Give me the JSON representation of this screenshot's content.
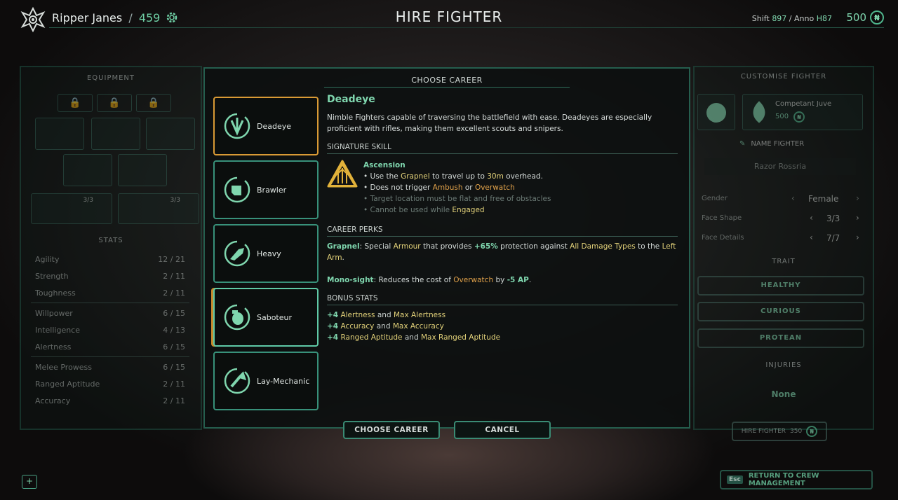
{
  "header": {
    "crew_name": "Ripper Janes",
    "separator": "/",
    "crew_points": "459",
    "title": "HIRE FIGHTER",
    "shift_label": "Shift",
    "shift_value": "897",
    "anno_label": "Anno",
    "anno_value": "H87",
    "currency": "500"
  },
  "left_panel": {
    "title": "EQUIPMENT",
    "weapons": [
      {
        "ammo": "3/3"
      },
      {
        "ammo": "3/3"
      }
    ],
    "stats_title": "STATS",
    "stats": [
      {
        "name": "Agility",
        "value": "12 / 21"
      },
      {
        "name": "Strength",
        "value": "2 / 11"
      },
      {
        "name": "Toughness",
        "value": "2 / 11"
      },
      {
        "name": "Willpower",
        "value": "6 / 15"
      },
      {
        "name": "Intelligence",
        "value": "4 / 13"
      },
      {
        "name": "Alertness",
        "value": "6 / 15"
      },
      {
        "name": "Melee Prowess",
        "value": "6 / 15"
      },
      {
        "name": "Ranged Aptitude",
        "value": "2 / 11"
      },
      {
        "name": "Accuracy",
        "value": "2 / 11"
      }
    ]
  },
  "right_panel": {
    "title": "CUSTOMISE FIGHTER",
    "juve_name": "Competant Juve",
    "juve_cost": "500",
    "name_label": "NAME FIGHTER",
    "fighter_name": "Razor Rossria",
    "gender_label": "Gender",
    "gender_value": "Female",
    "face_shape_label": "Face Shape",
    "face_shape_value": "3/3",
    "face_details_label": "Face Details",
    "face_details_value": "7/7",
    "trait_title": "TRAIT",
    "traits": [
      "HEALTHY",
      "CURIOUS",
      "PROTEAN"
    ],
    "injuries_title": "INJURIES",
    "injuries_value": "None",
    "hire_label": "HIRE FIGHTER",
    "hire_cost": "350",
    "return_key": "Esc",
    "return_label": "RETURN TO CREW MANAGEMENT"
  },
  "center": {
    "title": "CHOOSE CAREER",
    "careers": [
      {
        "label": "Deadeye",
        "icon": "crosshair-icon"
      },
      {
        "label": "Brawler",
        "icon": "fist-icon"
      },
      {
        "label": "Heavy",
        "icon": "heavy-gun-icon"
      },
      {
        "label": "Saboteur",
        "icon": "grenade-icon"
      },
      {
        "label": "Lay-Mechanic",
        "icon": "wrench-icon"
      }
    ],
    "selected_title": "Deadeye",
    "description": "Nimble Fighters capable of traversing the battlefield with ease. Deadeyes are especially proficient with rifles, making them excellent scouts and snipers.",
    "signature_header": "SIGNATURE SKILL",
    "skill_name": "Ascension",
    "skill_lines": {
      "l1a": "Use the",
      "l1b": "Grapnel",
      "l1c": "to travel up to",
      "l1d": "30m",
      "l1e": "overhead.",
      "l2a": "Does not trigger",
      "l2b": "Ambush",
      "l2c": "or",
      "l2d": "Overwatch",
      "l3": "Target location must be flat and free of obstacles",
      "l4a": "Cannot be used while",
      "l4b": "Engaged"
    },
    "perks_header": "CAREER PERKS",
    "perk1": {
      "name": "Grapnel",
      "a": "Special",
      "b": "Armour",
      "c": "that provides",
      "d": "+65%",
      "e": "protection against",
      "f": "All Damage Types",
      "g": "to the",
      "h": "Left Arm",
      "i": "."
    },
    "perk2": {
      "name": "Mono-sight",
      "a": "Reduces the cost of",
      "b": "Overwatch",
      "c": "by",
      "d": "-5 AP",
      "e": "."
    },
    "bonus_header": "BONUS STATS",
    "bonus": [
      {
        "amt": "+4",
        "a": "Alertness",
        "and": "and",
        "b": "Max Alertness"
      },
      {
        "amt": "+4",
        "a": "Accuracy",
        "and": "and",
        "b": "Max Accuracy"
      },
      {
        "amt": "+4",
        "a": "Ranged Aptitude",
        "and": "and",
        "b": "Max Ranged Aptitude"
      }
    ],
    "choose_button": "CHOOSE CAREER",
    "cancel_button": "CANCEL"
  },
  "colors": {
    "accent": "#7fd6ae",
    "selected_border": "#d99a35",
    "highlight_yellow": "#e3d27a",
    "highlight_orange": "#e0a14a"
  }
}
